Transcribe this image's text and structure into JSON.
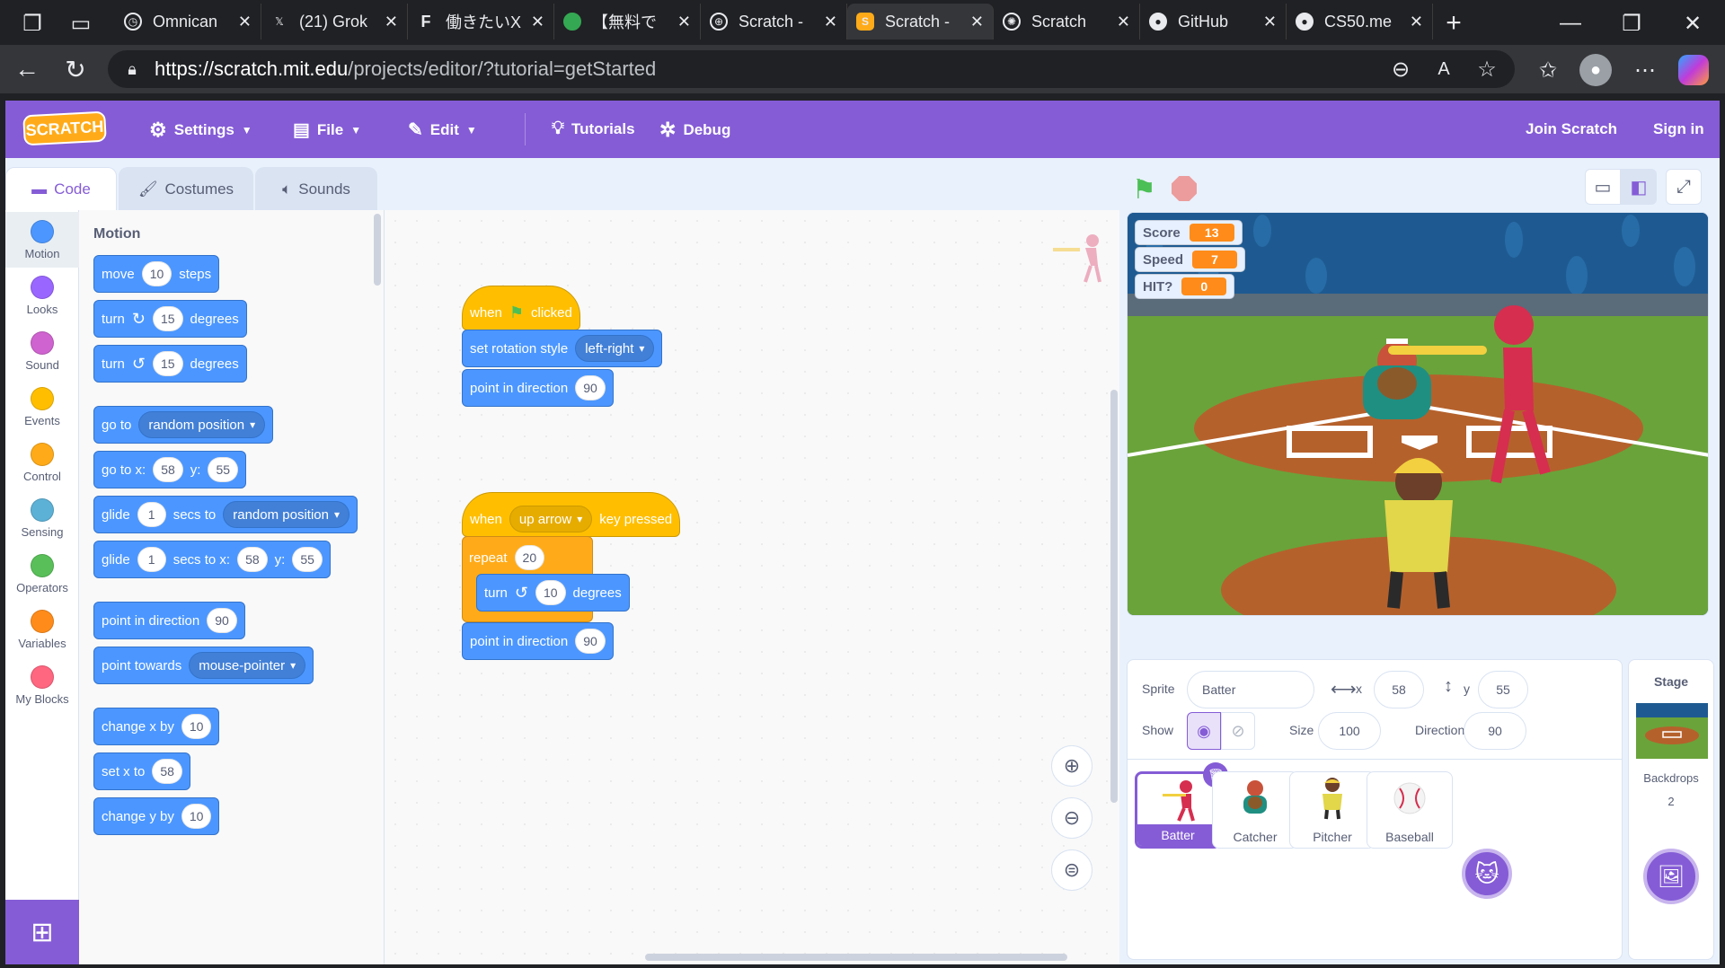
{
  "browser": {
    "tabs": [
      {
        "title": "Omnican",
        "icon": "clock-icon"
      },
      {
        "title": "(21) Grok",
        "icon": "x-icon"
      },
      {
        "title": "働きたいX",
        "icon": "f-icon"
      },
      {
        "title": "【無料で",
        "icon": "green-circle-icon"
      },
      {
        "title": "Scratch -",
        "icon": "globe-icon"
      },
      {
        "title": "Scratch -",
        "icon": "scratch-icon"
      },
      {
        "title": "Scratch",
        "icon": "openai-icon"
      },
      {
        "title": "GitHub",
        "icon": "github-icon"
      },
      {
        "title": "CS50.me",
        "icon": "github-icon"
      }
    ],
    "url_host": "https://scratch.mit.edu",
    "url_path": "/projects/editor/?tutorial=getStarted"
  },
  "menu": {
    "logo": "SCRATCH",
    "settings": "Settings",
    "file": "File",
    "edit": "Edit",
    "tutorials": "Tutorials",
    "debug": "Debug",
    "join": "Join Scratch",
    "signin": "Sign in"
  },
  "editor_tabs": {
    "code": "Code",
    "costumes": "Costumes",
    "sounds": "Sounds"
  },
  "categories": [
    {
      "label": "Motion",
      "color": "#4c97ff"
    },
    {
      "label": "Looks",
      "color": "#9966ff"
    },
    {
      "label": "Sound",
      "color": "#cf63cf"
    },
    {
      "label": "Events",
      "color": "#ffbf00"
    },
    {
      "label": "Control",
      "color": "#ffab19"
    },
    {
      "label": "Sensing",
      "color": "#5cb1d6"
    },
    {
      "label": "Operators",
      "color": "#59c059"
    },
    {
      "label": "Variables",
      "color": "#ff8c1a"
    },
    {
      "label": "My Blocks",
      "color": "#ff6680"
    }
  ],
  "palette": {
    "heading": "Motion",
    "move": {
      "a": "move",
      "n": "10",
      "b": "steps"
    },
    "turn_right": {
      "a": "turn",
      "n": "15",
      "b": "degrees"
    },
    "turn_left": {
      "a": "turn",
      "n": "15",
      "b": "degrees"
    },
    "goto": {
      "a": "go to",
      "d": "random position"
    },
    "gotoxy": {
      "a": "go to x:",
      "x": "58",
      "b": "y:",
      "y": "55"
    },
    "glide1": {
      "a": "glide",
      "n": "1",
      "b": "secs to",
      "d": "random position"
    },
    "glide2": {
      "a": "glide",
      "n": "1",
      "b": "secs to x:",
      "x": "58",
      "c": "y:",
      "y": "55"
    },
    "point": {
      "a": "point in direction",
      "n": "90"
    },
    "towards": {
      "a": "point towards",
      "d": "mouse-pointer"
    },
    "changex": {
      "a": "change x by",
      "n": "10"
    },
    "setx": {
      "a": "set x to",
      "n": "58"
    },
    "changey": {
      "a": "change y by",
      "n": "10"
    }
  },
  "script1": {
    "when": "when",
    "clicked": "clicked",
    "rot_label": "set rotation style",
    "rot_value": "left-right",
    "point_label": "point in direction",
    "point_value": "90"
  },
  "script2": {
    "when": "when",
    "key": "up arrow",
    "pressed": "key pressed",
    "repeat": "repeat",
    "repeat_n": "20",
    "turn": "turn",
    "turn_n": "10",
    "turn_b": "degrees",
    "point_label": "point in direction",
    "point_value": "90"
  },
  "monitors": [
    {
      "label": "Score",
      "value": "13"
    },
    {
      "label": "Speed",
      "value": "7"
    },
    {
      "label": "HIT?",
      "value": "0"
    }
  ],
  "sprite_info": {
    "sprite_label": "Sprite",
    "sprite_name": "Batter",
    "x_label": "x",
    "x": "58",
    "y_label": "y",
    "y": "55",
    "show_label": "Show",
    "size_label": "Size",
    "size": "100",
    "direction_label": "Direction",
    "direction": "90"
  },
  "sprites": [
    {
      "name": "Batter"
    },
    {
      "name": "Catcher"
    },
    {
      "name": "Pitcher"
    },
    {
      "name": "Baseball"
    }
  ],
  "stage_panel": {
    "title": "Stage",
    "backdrops_label": "Backdrops",
    "backdrops_count": "2"
  },
  "colors": {
    "scratch_purple": "#855cd6",
    "motion": "#4c97ff",
    "events": "#ffbf00",
    "control": "#ffab19"
  }
}
